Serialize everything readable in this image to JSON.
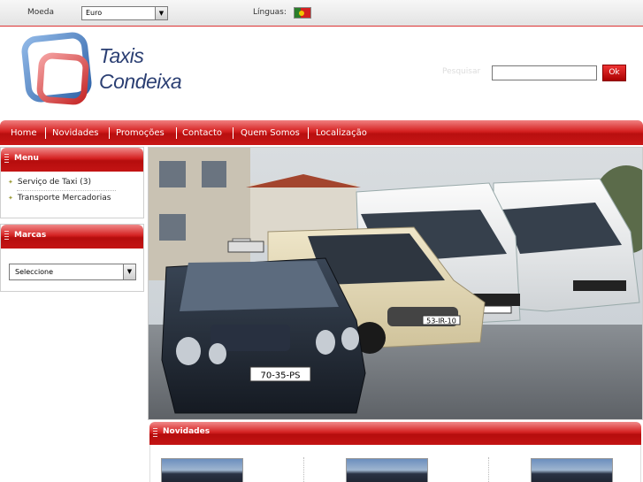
{
  "topbar": {
    "currency_label": "Moeda",
    "currency_value": "Euro",
    "language_label": "Línguas:",
    "flag_icon": "portugal-flag-icon"
  },
  "header": {
    "logo_line1": "Taxis",
    "logo_line2": "Condeixa",
    "search_label": "Pesquisar",
    "search_value": "",
    "ok_label": "Ok"
  },
  "nav": {
    "items": [
      "Home",
      "Novidades",
      "Promoções",
      "Contacto",
      "Quem Somos",
      "Localização"
    ]
  },
  "sidebar": {
    "menu_title": "Menu",
    "menu_items": [
      "Serviço de Taxi (3)",
      "Transporte Mercadorias"
    ],
    "brands_title": "Marcas",
    "brands_select": "Seleccione"
  },
  "main": {
    "plate_1": "70-35-PS",
    "plate_2": "53-IR-10"
  },
  "novidades": {
    "title": "Novidades"
  },
  "colors": {
    "accent_red": "#c81616",
    "logo_blue": "#2b3f73"
  }
}
